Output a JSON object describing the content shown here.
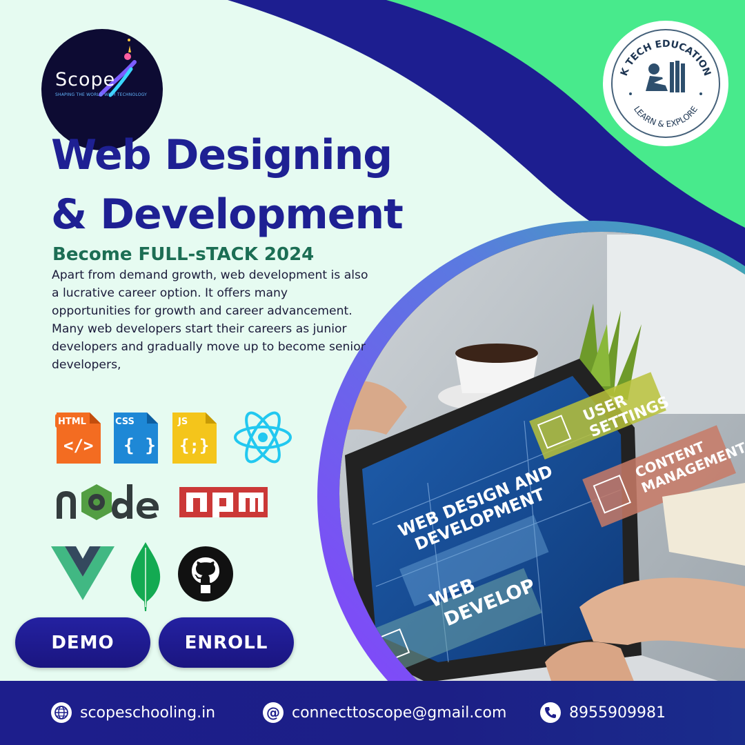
{
  "logo": {
    "word": "Scope",
    "tagline": "SHAPING THE WORLD WITH TECHNOLOGY"
  },
  "badge": {
    "top_text": "K TECH EDUCATION",
    "bottom_text": "LEARN & EXPLORE"
  },
  "headline": {
    "line1": "Web Designing",
    "line2": "& Development"
  },
  "subtitle": "Become FULL-sTACK 2024",
  "description": "Apart from demand growth, web development is also a lucrative career option. It offers many opportunities for growth and career advancement. Many web developers start their careers as junior developers and gradually move up to become senior developers,",
  "tech_icons": {
    "html": "HTML",
    "css": "CSS",
    "js": "JS",
    "node": "node",
    "npm": "npm"
  },
  "buttons": {
    "demo": "DEMO",
    "enroll": "ENROLL"
  },
  "screen": {
    "user_settings_1": "USER",
    "user_settings_2": "SETTINGS",
    "content_1": "CONTENT",
    "content_2": "MANAGEMENT",
    "wdd_1": "WEB DESIGN AND",
    "wdd_2": "DEVELOPMENT",
    "web_1": "WEB",
    "web_2": "DEVELOP"
  },
  "footer": {
    "website": "scopeschooling.in",
    "email": "connecttoscope@gmail.com",
    "phone": "8955909981"
  },
  "colors": {
    "navy": "#1e2093",
    "green_accent": "#46e98e",
    "teal_text": "#1c6e54",
    "light_bg": "#e6fbf1",
    "purple_ring": "#7c4dff"
  }
}
